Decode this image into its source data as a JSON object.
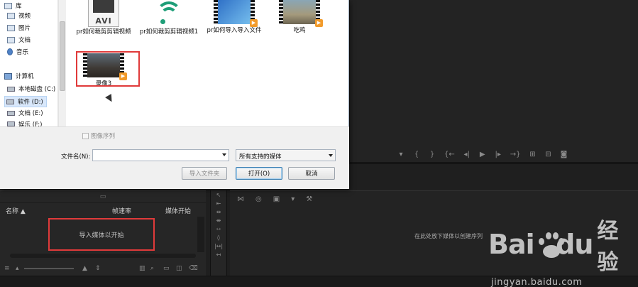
{
  "dialog": {
    "sidebar": {
      "items": [
        {
          "label": "库",
          "icon": "library-icon"
        },
        {
          "label": "视频",
          "icon": "videos-folder-icon"
        },
        {
          "label": "图片",
          "icon": "pictures-folder-icon"
        },
        {
          "label": "文档",
          "icon": "documents-folder-icon"
        },
        {
          "label": "音乐",
          "icon": "music-folder-icon"
        },
        {
          "label": "计算机",
          "icon": "computer-icon"
        },
        {
          "label": "本地磁盘 (C:)",
          "icon": "drive-icon"
        },
        {
          "label": "软件 (D:)",
          "icon": "drive-icon"
        },
        {
          "label": "文档 (E:)",
          "icon": "drive-icon"
        },
        {
          "label": "娱乐 (F:)",
          "icon": "drive-icon"
        }
      ]
    },
    "files": [
      {
        "name": "pr如何裁剪剪辑视频",
        "type": "avi"
      },
      {
        "name": "pr如何裁剪剪辑视频1",
        "type": "wifi"
      },
      {
        "name": "pr如何导入导入文件",
        "type": "video-win"
      },
      {
        "name": "吃鸡",
        "type": "video-game"
      },
      {
        "name": "录像3",
        "type": "video-rec"
      }
    ],
    "image_sequence_label": "图像序列",
    "filename_label": "文件名(N):",
    "filename_value": "",
    "file_type_value": "所有支持的媒体",
    "buttons": {
      "import_folder": "导入文件夹",
      "open": "打开(O)",
      "cancel": "取消"
    }
  },
  "project_panel": {
    "columns": [
      "名称",
      "帧速率",
      "媒体开始"
    ],
    "empty_message": "导入媒体以开始"
  },
  "timeline": {
    "empty_message": "在此处放下媒体以创建序列"
  },
  "watermark": {
    "brand_cn": "经验",
    "url": "jingyan.baidu.com"
  },
  "colors": {
    "highlight_box": "#e03a3a",
    "app_bg": "#1f1f1f",
    "dialog_bg": "#ffffff"
  }
}
